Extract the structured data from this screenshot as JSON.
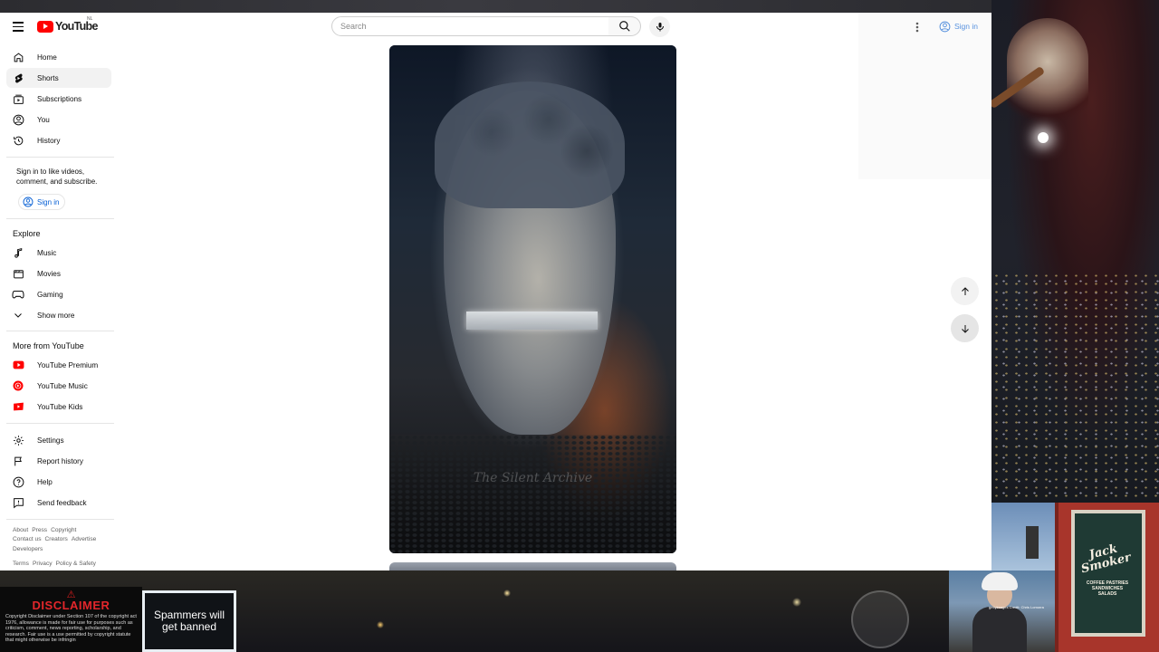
{
  "masthead": {
    "logo_text": "YouTube",
    "country_code": "NL",
    "search_placeholder": "Search",
    "signin_label": "Sign in"
  },
  "sidebar": {
    "main": [
      {
        "label": "Home",
        "icon": "home-icon"
      },
      {
        "label": "Shorts",
        "icon": "shorts-icon",
        "active": true
      },
      {
        "label": "Subscriptions",
        "icon": "subscriptions-icon"
      },
      {
        "label": "You",
        "icon": "you-icon"
      },
      {
        "label": "History",
        "icon": "history-icon"
      }
    ],
    "signin_message": "Sign in to like videos, comment, and subscribe.",
    "signin_label": "Sign in",
    "explore_title": "Explore",
    "explore": [
      {
        "label": "Music",
        "icon": "music-icon"
      },
      {
        "label": "Movies",
        "icon": "movies-icon"
      },
      {
        "label": "Gaming",
        "icon": "gaming-icon"
      },
      {
        "label": "Show more",
        "icon": "chevron-down-icon"
      }
    ],
    "more_title": "More from YouTube",
    "more": [
      {
        "label": "YouTube Premium",
        "icon": "youtube-premium-icon"
      },
      {
        "label": "YouTube Music",
        "icon": "youtube-music-icon"
      },
      {
        "label": "YouTube Kids",
        "icon": "youtube-kids-icon"
      }
    ],
    "settings": [
      {
        "label": "Settings",
        "icon": "gear-icon"
      },
      {
        "label": "Report history",
        "icon": "flag-icon"
      },
      {
        "label": "Help",
        "icon": "help-icon"
      },
      {
        "label": "Send feedback",
        "icon": "feedback-icon"
      }
    ],
    "footer": {
      "line1": [
        "About",
        "Press",
        "Copyright"
      ],
      "line2": [
        "Contact us",
        "Creators",
        "Advertise"
      ],
      "line3": [
        "Developers"
      ],
      "line4": [
        "Terms",
        "Privacy",
        "Policy & Safety"
      ]
    }
  },
  "short": {
    "watermark": "The Silent Archive"
  },
  "stream_overlay": {
    "disclaimer_title": "DISCLAIMER",
    "disclaimer_body": "Copyright Disclaimer under Section 107 of the copyright act 1976, allowance is made for fair use for purposes such as criticism, comment, news reporting, scholarship, and research. Fair use is a use permitted by copyright statute that might otherwise be infringin",
    "spam_banner": "Spammers will get banned",
    "shop_sign": "Jack Smoker",
    "shop_sub": "COFFEE PASTRIES SANDWICHES SALADS",
    "cam_caption": "gettyimages Credit: Chris Lomorra"
  },
  "colors": {
    "accent_blue": "#065fd4",
    "youtube_red": "#ff0000"
  }
}
